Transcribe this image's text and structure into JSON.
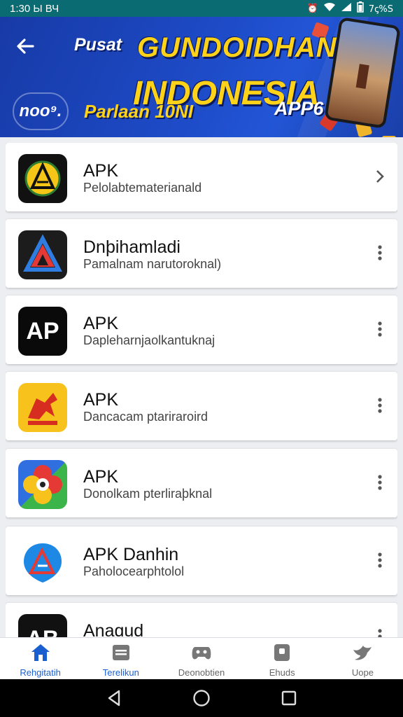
{
  "status_bar": {
    "time": "1:30 Ы ВЧ",
    "battery": "7ꞔ%S"
  },
  "header": {
    "back_icon": "arrow-left-icon",
    "banner": {
      "pusat": "Pusat",
      "headline_line1": "GUNDOIDHAN",
      "headline_line2": "INDONESIA",
      "logo_text": "noo⁹.",
      "subline": "Parlaan 10NI",
      "apps_text": "APP6"
    }
  },
  "apps": [
    {
      "name": "APK",
      "description": "Pelolabtematerianald",
      "icon": "gold-emblem-icon",
      "action_icon": "chevron-right-icon"
    },
    {
      "name": "Dnþihamladi",
      "description": "Pamalnam narutoroknal)",
      "icon": "red-a-triangle-icon",
      "action_icon": "more-vert-icon"
    },
    {
      "name": "APK",
      "description": "Dapleharnjaolkantuknaj",
      "icon": "ap-text-icon",
      "action_icon": "more-vert-icon"
    },
    {
      "name": "APK",
      "description": "Dancacam ptariraroird",
      "icon": "red-horse-icon",
      "action_icon": "more-vert-icon"
    },
    {
      "name": "APK",
      "description": "Donolkam pterliraþknal",
      "icon": "flower-icon",
      "action_icon": "more-vert-icon"
    },
    {
      "name": "APK Danhin",
      "description": "Paholocearphtolol",
      "icon": "blue-a-pin-icon",
      "action_icon": "more-vert-icon"
    },
    {
      "name": "Anaɑud",
      "description": "",
      "icon": "ab-text-icon",
      "action_icon": "more-vert-icon",
      "icon_text": "AB"
    }
  ],
  "app_icon_texts": {
    "ap": "AP"
  },
  "bottom_nav": [
    {
      "label": "Rehgitatih",
      "icon": "home-icon",
      "active": true
    },
    {
      "label": "Terelikun",
      "icon": "archive-icon",
      "active": false
    },
    {
      "label": "Deonobtien",
      "icon": "gamepad-icon",
      "active": false
    },
    {
      "label": "Ehuds",
      "icon": "phone-icon",
      "active": false
    },
    {
      "label": "Uope",
      "icon": "bird-icon",
      "active": false
    }
  ],
  "colors": {
    "status_bar": "#0b6b73",
    "banner": "#1d49c4",
    "accent": "#1a5fd0",
    "headline": "#ffd21a"
  }
}
